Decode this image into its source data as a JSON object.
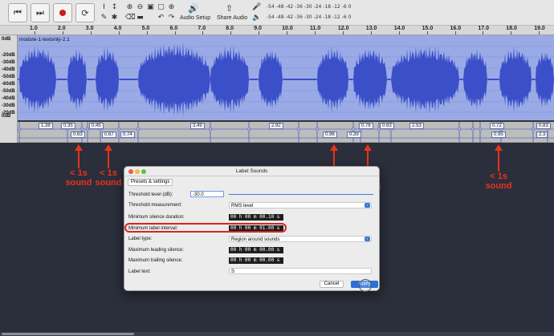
{
  "toolbar": {
    "audio_setup_label": "Audio Setup",
    "share_audio_label": "Share Audio",
    "meter_ticks": "-54  -48  -42  -36  -30  -24  -18  -12  -6   0",
    "colors": {
      "record": "#c81e1e",
      "bg": "#e6e6e6"
    },
    "icons": [
      "skip-start-icon",
      "skip-end-icon",
      "record-icon",
      "loop-icon",
      "select-tool-icon",
      "envelope-tool-icon",
      "draw-tool-icon",
      "multi-tool-icon",
      "zoom-in-icon",
      "zoom-out-icon",
      "fit-selection-icon",
      "fit-project-icon",
      "zoom-toggle-icon",
      "trim-icon",
      "silence-icon",
      "undo-icon",
      "redo-icon",
      "speaker-icon",
      "mic-icon",
      "play-meter-icon",
      "record-meter-icon"
    ]
  },
  "ruler": {
    "ticks": [
      "1.0",
      "2.0",
      "3.0",
      "4.0",
      "5.0",
      "6.0",
      "7.0",
      "8.0",
      "9.0",
      "10.0",
      "11.0",
      "12.0",
      "13.0",
      "14.0",
      "15.0",
      "16.0",
      "17.0",
      "18.0",
      "19.0"
    ]
  },
  "track": {
    "clip_name": "module-1-textonly-2.1",
    "db_labels": [
      "0dB",
      "-20dB",
      "-30dB",
      "-40dB",
      "-50dB",
      "-60dB",
      "-50dB",
      "-40dB",
      "-30dB",
      "-20dB",
      "0dB"
    ],
    "wave_color": "#3b4fc8",
    "bg_color": "#9aaae6"
  },
  "labels": {
    "top": [
      "1.38",
      "0.35",
      "0.45",
      "3.49",
      "2.92",
      "0.76",
      "0.63",
      "2.53",
      "0.72",
      "0.83"
    ],
    "bottom": [
      "0.63",
      "0.67",
      "0.74",
      "0.96",
      "0.39",
      "0.95",
      "2.3"
    ]
  },
  "annotations": [
    {
      "line1": "< 1s",
      "line2": "sound"
    },
    {
      "line1": "< 1s",
      "line2": "sound"
    },
    {
      "line1": "< 1s",
      "line2": "sound"
    },
    {
      "line1": "< 1s",
      "line2": "sound"
    },
    {
      "line1": "< 1s",
      "line2": "sound"
    }
  ],
  "dialog": {
    "title": "Label Sounds",
    "presets_label": "Presets & settings",
    "threshold_level_label": "Threshold level (dB):",
    "threshold_level_value": "-30.0",
    "threshold_measurement_label": "Threshold measurement:",
    "threshold_measurement_value": "RMS level",
    "min_silence_label": "Minimum silence duration:",
    "min_silence_value": "00 h 00 m 00.10 s",
    "min_label_interval_label": "Minimum label interval:",
    "min_label_interval_value": "00 h 00 m 01.00 s",
    "label_type_label": "Label type:",
    "label_type_value": "Region around sounds",
    "max_leading_label": "Maximum leading silence:",
    "max_leading_value": "00 h 00 m 00.00 s",
    "max_trailing_label": "Maximum trailing silence:",
    "max_trailing_value": "00 h 00 m 00.00 s",
    "label_text_label": "Label text:",
    "label_text_value": "S",
    "cancel_label": "Cancel",
    "apply_label": "Apply",
    "highlight_color": "#d7261b"
  }
}
